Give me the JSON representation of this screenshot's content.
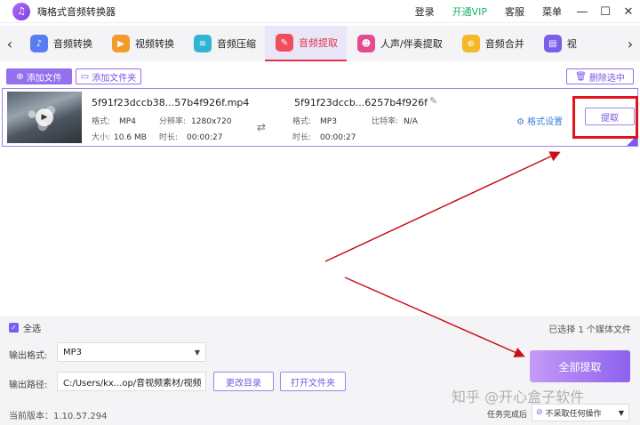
{
  "app": {
    "title": "嗨格式音频转换器",
    "links": [
      "登录",
      "开通VIP",
      "客服",
      "菜单"
    ]
  },
  "tabs": [
    {
      "label": "音频转换",
      "icon": "audio-convert-icon"
    },
    {
      "label": "视频转换",
      "icon": "video-convert-icon"
    },
    {
      "label": "音频压缩",
      "icon": "audio-compress-icon"
    },
    {
      "label": "音频提取",
      "icon": "audio-extract-icon",
      "active": true
    },
    {
      "label": "人声/伴奏提取",
      "icon": "vocal-extract-icon"
    },
    {
      "label": "音频合并",
      "icon": "audio-merge-icon"
    },
    {
      "label": "视",
      "icon": "video-icon"
    }
  ],
  "toolbar": {
    "add_file": "添加文件",
    "add_folder": "添加文件夹",
    "delete_selected": "删除选中"
  },
  "file": {
    "source_name": "5f91f23dccb38...57b4f926f.mp4",
    "source_format_label": "格式:",
    "source_format": "MP4",
    "source_resolution_label": "分辨率:",
    "source_resolution": "1280x720",
    "source_size_label": "大小:",
    "source_size": "10.6 MB",
    "source_duration_label": "时长:",
    "source_duration": "00:00:27",
    "output_name": "5f91f23dccb...6257b4f926f",
    "output_format_label": "格式:",
    "output_format": "MP3",
    "output_bitrate_label": "比特率:",
    "output_bitrate": "N/A",
    "output_duration_label": "时长:",
    "output_duration": "00:00:27",
    "format_settings": "格式设置",
    "extract_button": "提取"
  },
  "bottom": {
    "select_all": "全选",
    "selected_count": "已选择 1 个媒体文件",
    "output_format_label": "输出格式:",
    "output_format": "MP3",
    "output_path_label": "输出路径:",
    "output_path": "C:/Users/kx...op/音视频素材/视频",
    "change_dir": "更改目录",
    "open_folder": "打开文件夹",
    "extract_all": "全部提取",
    "version": "当前版本：1.10.57.294",
    "after_task_label": "任务完成后",
    "after_task_value": "不采取任何操作"
  },
  "watermark": "知乎 @开心盒子软件",
  "colors": {
    "accent": "#9470ee",
    "active_tab": "#e0344f",
    "highlight": "#e0141e",
    "vip": "#1db069"
  }
}
